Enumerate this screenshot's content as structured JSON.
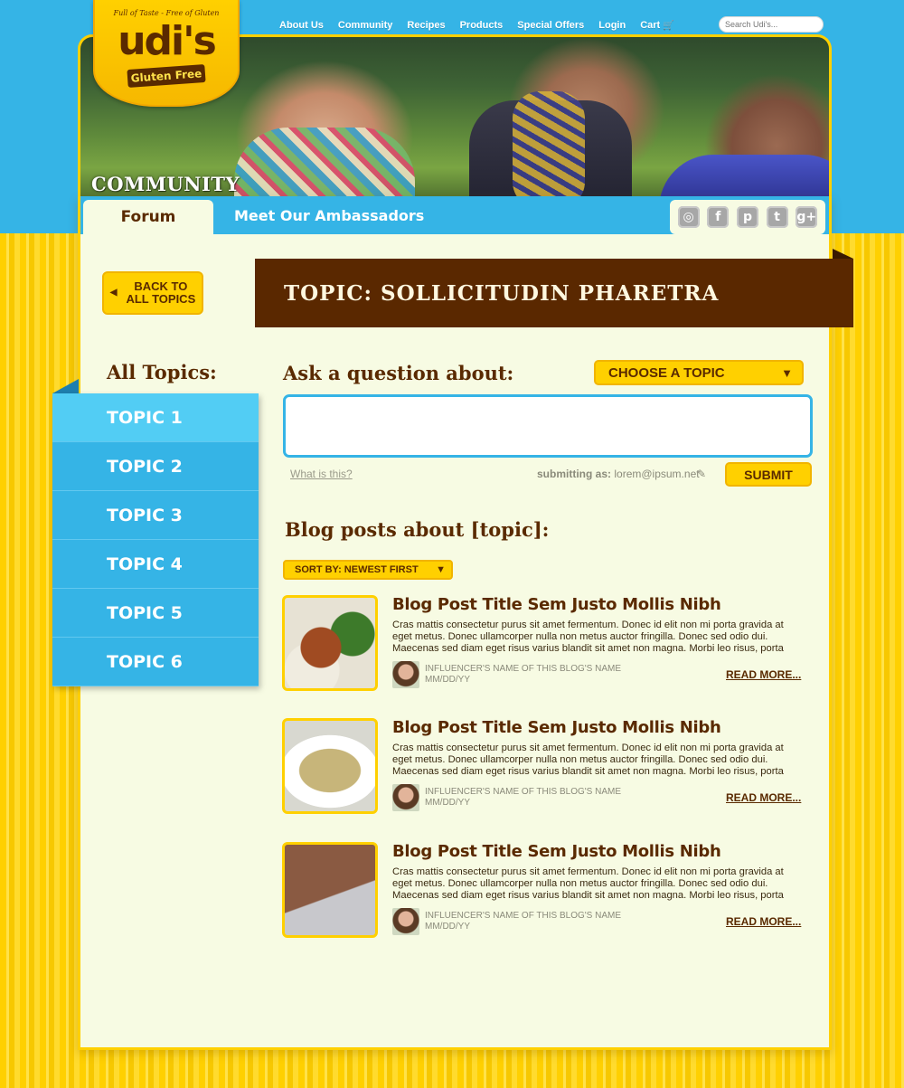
{
  "nav": {
    "items": [
      "About Us",
      "Community",
      "Recipes",
      "Products",
      "Special Offers",
      "Login",
      "Cart"
    ],
    "search_placeholder": "Search Udi's..."
  },
  "logo": {
    "tagline": "Full of Taste - Free of Gluten",
    "mark": "udi's",
    "sub": "Gluten Free"
  },
  "hero": {
    "title": "COMMUNITY"
  },
  "tabs": {
    "forum": "Forum",
    "ambassadors": "Meet Our Ambassadors"
  },
  "social": [
    "instagram-icon",
    "facebook-icon",
    "pinterest-icon",
    "twitter-icon",
    "googleplus-icon"
  ],
  "back_button": {
    "line1": "BACK TO",
    "line2": "ALL TOPICS"
  },
  "topic_title": "TOPIC: SOLLICITUDIN PHARETRA",
  "sidebar": {
    "label": "All Topics:",
    "topics": [
      "TOPIC 1",
      "TOPIC 2",
      "TOPIC 3",
      "TOPIC 4",
      "TOPIC 5",
      "TOPIC 6"
    ]
  },
  "ask": {
    "label": "Ask a question about:",
    "choose_label": "CHOOSE A TOPIC",
    "what_link": "What is this?",
    "submitting_label": "submitting as:",
    "submitting_email": "lorem@ipsum.net",
    "submit_label": "SUBMIT"
  },
  "blog": {
    "heading": "Blog posts about [topic]:",
    "sort_label": "SORT BY: NEWEST FIRST",
    "posts": [
      {
        "title": "Blog Post Title Sem Justo Mollis Nibh",
        "excerpt": "Cras mattis consectetur purus sit amet fermentum. Donec id elit non mi porta gravida at eget metus. Donec ullamcorper nulla non metus auctor fringilla. Donec sed odio dui. Maecenas sed diam eget risus varius blandit sit amet non magna. Morbi leo risus, porta",
        "influencer": "INFLUENCER'S NAME OF THIS BLOG'S NAME",
        "date": "MM/DD/YY",
        "read_more": "READ MORE..."
      },
      {
        "title": "Blog Post Title Sem Justo Mollis Nibh",
        "excerpt": "Cras mattis consectetur purus sit amet fermentum. Donec id elit non mi porta gravida at eget metus. Donec ullamcorper nulla non metus auctor fringilla. Donec sed odio dui. Maecenas sed diam eget risus varius blandit sit amet non magna. Morbi leo risus, porta",
        "influencer": "INFLUENCER'S NAME OF THIS BLOG'S NAME",
        "date": "MM/DD/YY",
        "read_more": "READ MORE..."
      },
      {
        "title": "Blog Post Title Sem Justo Mollis Nibh",
        "excerpt": "Cras mattis consectetur purus sit amet fermentum. Donec id elit non mi porta gravida at eget metus. Donec ullamcorper nulla non metus auctor fringilla. Donec sed odio dui. Maecenas sed diam eget risus varius blandit sit amet non magna. Morbi leo risus, porta",
        "influencer": "INFLUENCER'S NAME OF THIS BLOG'S NAME",
        "date": "MM/DD/YY",
        "read_more": "READ MORE..."
      }
    ]
  },
  "colors": {
    "sky": "#35b4e6",
    "yellow": "#ffd000",
    "brown": "#5a2800",
    "cream": "#f7fbe3"
  }
}
